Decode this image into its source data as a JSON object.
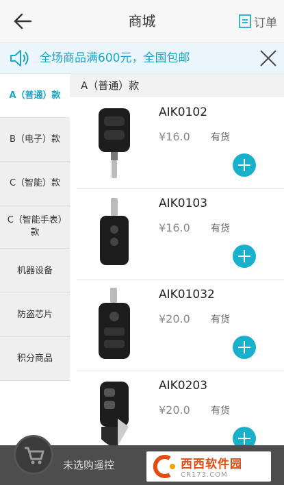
{
  "header": {
    "title": "商城",
    "orders_label": "订单",
    "back_icon": "arrow-left-icon",
    "orders_icon": "order-list-icon"
  },
  "notice": {
    "text": "全场商品满600元，全国包邮",
    "icon": "speaker-icon",
    "close_icon": "close-icon"
  },
  "sidebar": {
    "items": [
      {
        "label": "A（普通）款",
        "active": true
      },
      {
        "label": "B（电子）款",
        "active": false
      },
      {
        "label": "C（智能）款",
        "active": false
      },
      {
        "label": "C（智能手表）款",
        "active": false
      },
      {
        "label": "机器设备",
        "active": false
      },
      {
        "label": "防盗芯片",
        "active": false
      },
      {
        "label": "积分商品",
        "active": false
      }
    ]
  },
  "section": {
    "title": "A（普通）款"
  },
  "products": [
    {
      "name": "AIK0102",
      "price": "¥16.0",
      "stock": "有货"
    },
    {
      "name": "AIK0103",
      "price": "¥16.0",
      "stock": "有货"
    },
    {
      "name": "AIK01032",
      "price": "¥20.0",
      "stock": "有货"
    },
    {
      "name": "AIK0203",
      "price": "¥20.0",
      "stock": "有货"
    }
  ],
  "footer": {
    "cart_label": "未选购遥控",
    "cart_icon": "shopping-cart-icon",
    "watermark_main": "西西软件园",
    "watermark_sub": "CR173.COM"
  },
  "colors": {
    "accent": "#19b0cb",
    "notice_text": "#19a7c5",
    "footer_bg": "#4d4d4d",
    "watermark": "#e14b14"
  }
}
